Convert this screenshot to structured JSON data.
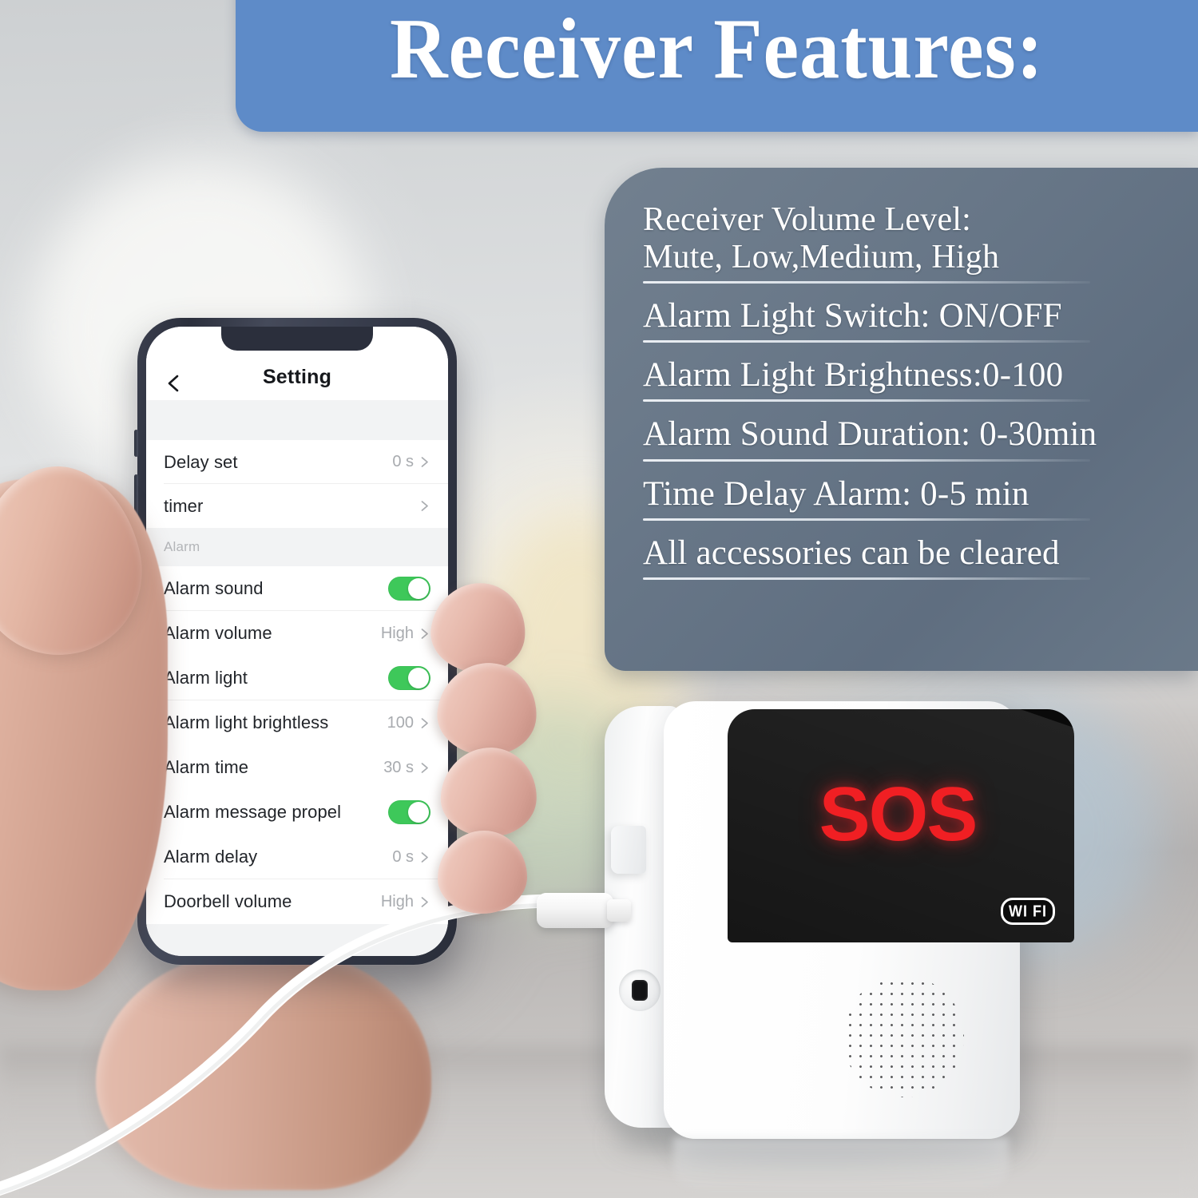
{
  "banner": {
    "title": "Receiver Features:",
    "color": "#5e8bc8"
  },
  "feature_panel": {
    "background_color": "#687787",
    "items": [
      {
        "text": "Receiver Volume Level:\nMute, Low,Medium, High"
      },
      {
        "text": "Alarm Light Switch: ON/OFF"
      },
      {
        "text": "Alarm Light Brightness:0-100"
      },
      {
        "text": "Alarm Sound Duration: 0-30min"
      },
      {
        "text": "Time Delay Alarm: 0-5 min"
      },
      {
        "text": "All accessories can be cleared"
      }
    ]
  },
  "phone_app": {
    "header": {
      "title": "Setting",
      "back_icon": "chevron-left-icon"
    },
    "section_label": "Alarm",
    "rows_top": [
      {
        "label": "Delay set",
        "value": "0 s",
        "control": "chevron",
        "chevron_icon": "chevron-right-icon"
      },
      {
        "label": "timer",
        "value": "",
        "control": "chevron",
        "chevron_icon": "chevron-right-icon"
      }
    ],
    "rows_alarm": [
      {
        "label": "Alarm sound",
        "value": "",
        "control": "toggle",
        "toggle_on": true
      },
      {
        "label": "Alarm volume",
        "value": "High",
        "control": "chevron",
        "chevron_icon": "chevron-right-icon"
      },
      {
        "label": "Alarm light",
        "value": "",
        "control": "toggle",
        "toggle_on": true
      },
      {
        "label": "Alarm light brightless",
        "value": "100",
        "control": "chevron",
        "chevron_icon": "chevron-right-icon"
      },
      {
        "label": "Alarm time",
        "value": "30 s",
        "control": "chevron",
        "chevron_icon": "chevron-right-icon"
      },
      {
        "label": "Alarm message propel",
        "value": "",
        "control": "toggle",
        "toggle_on": true
      },
      {
        "label": "Alarm delay",
        "value": "0 s",
        "control": "chevron",
        "chevron_icon": "chevron-right-icon"
      },
      {
        "label": "Doorbell volume",
        "value": "High",
        "control": "chevron",
        "chevron_icon": "chevron-right-icon"
      }
    ],
    "toggle_on_color": "#3ec85a"
  },
  "device": {
    "display_text": "SOS",
    "display_text_color": "#f01f23",
    "wifi_badge_label": "WI FI",
    "speaker_icon": "speaker-grille-icon",
    "port_icon": "power-port-icon",
    "cable_icon": "usb-cable-icon"
  }
}
